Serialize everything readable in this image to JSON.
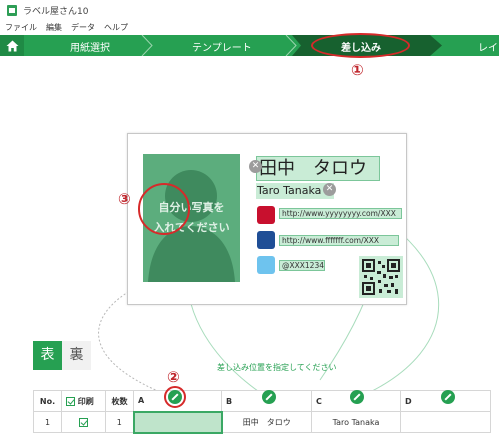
{
  "window": {
    "title": "ラベル屋さん10"
  },
  "menu": [
    "ファイル",
    "編集",
    "データ",
    "ヘルプ"
  ],
  "steps": [
    "用紙選択",
    "テンプレート",
    "差し込み",
    "レイア"
  ],
  "annotations": [
    "①",
    "②",
    "③"
  ],
  "card": {
    "photo_text_line1": "自分い写真を",
    "photo_text_line2": "入れてください",
    "name_jp": "田中　タロウ",
    "name_en": "Taro Tanaka",
    "url1": "http://www.yyyyyyyy.com/XXX",
    "url2": "http://www.fffffff.com/XXX",
    "handle": "@XXX1234"
  },
  "tabs": {
    "front": "表",
    "back": "裏"
  },
  "hint": "差し込み位置を指定してください",
  "table": {
    "headers": [
      "No.",
      "印刷",
      "枚数",
      "A",
      "B",
      "C",
      "D"
    ],
    "rows": [
      [
        "1",
        "",
        "1",
        "",
        "田中　タロウ",
        "Taro Tanaka",
        ""
      ]
    ]
  },
  "colors": {
    "accent": "#26a052",
    "active_step": "#17612f",
    "annotation": "#d62a2a",
    "red_square": "#c8102e",
    "blue_square": "#1f4e96",
    "light_blue_square": "#6ec3ee"
  }
}
